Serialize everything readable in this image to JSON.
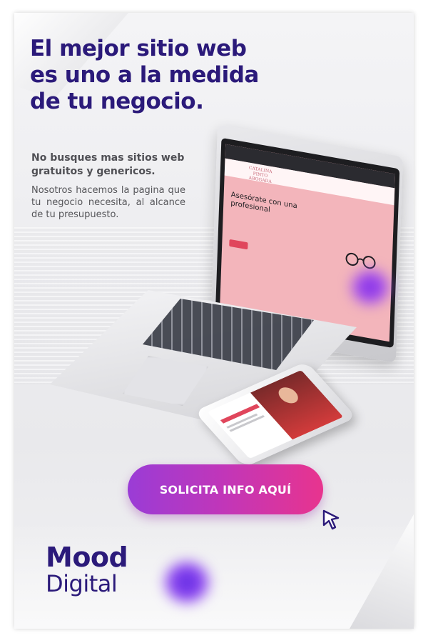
{
  "headline": {
    "line1": "El mejor sitio web",
    "line2": "es uno a la medida",
    "line3": "de tu negocio."
  },
  "subheadline": "No busques mas sitios web gratuitos y genericos.",
  "description": "Nosotros hacemos la pagina que tu negocio necesita, al alcance de tu presupuesto.",
  "mockup": {
    "laptop_site_heading": "Asesórate con una profesional",
    "laptop_site_logo": "CATALINA PINTO ABOGADA"
  },
  "cta": {
    "label": "SOLICITA INFO AQUÍ"
  },
  "brand": {
    "line1": "Mood",
    "line2": "Digital"
  },
  "colors": {
    "headline": "#2b1a7a",
    "cta_start": "#9a3cd6",
    "cta_end": "#e8348e",
    "brand": "#2b1a7a"
  },
  "icons": {
    "cursor": "mouse-pointer-icon"
  }
}
